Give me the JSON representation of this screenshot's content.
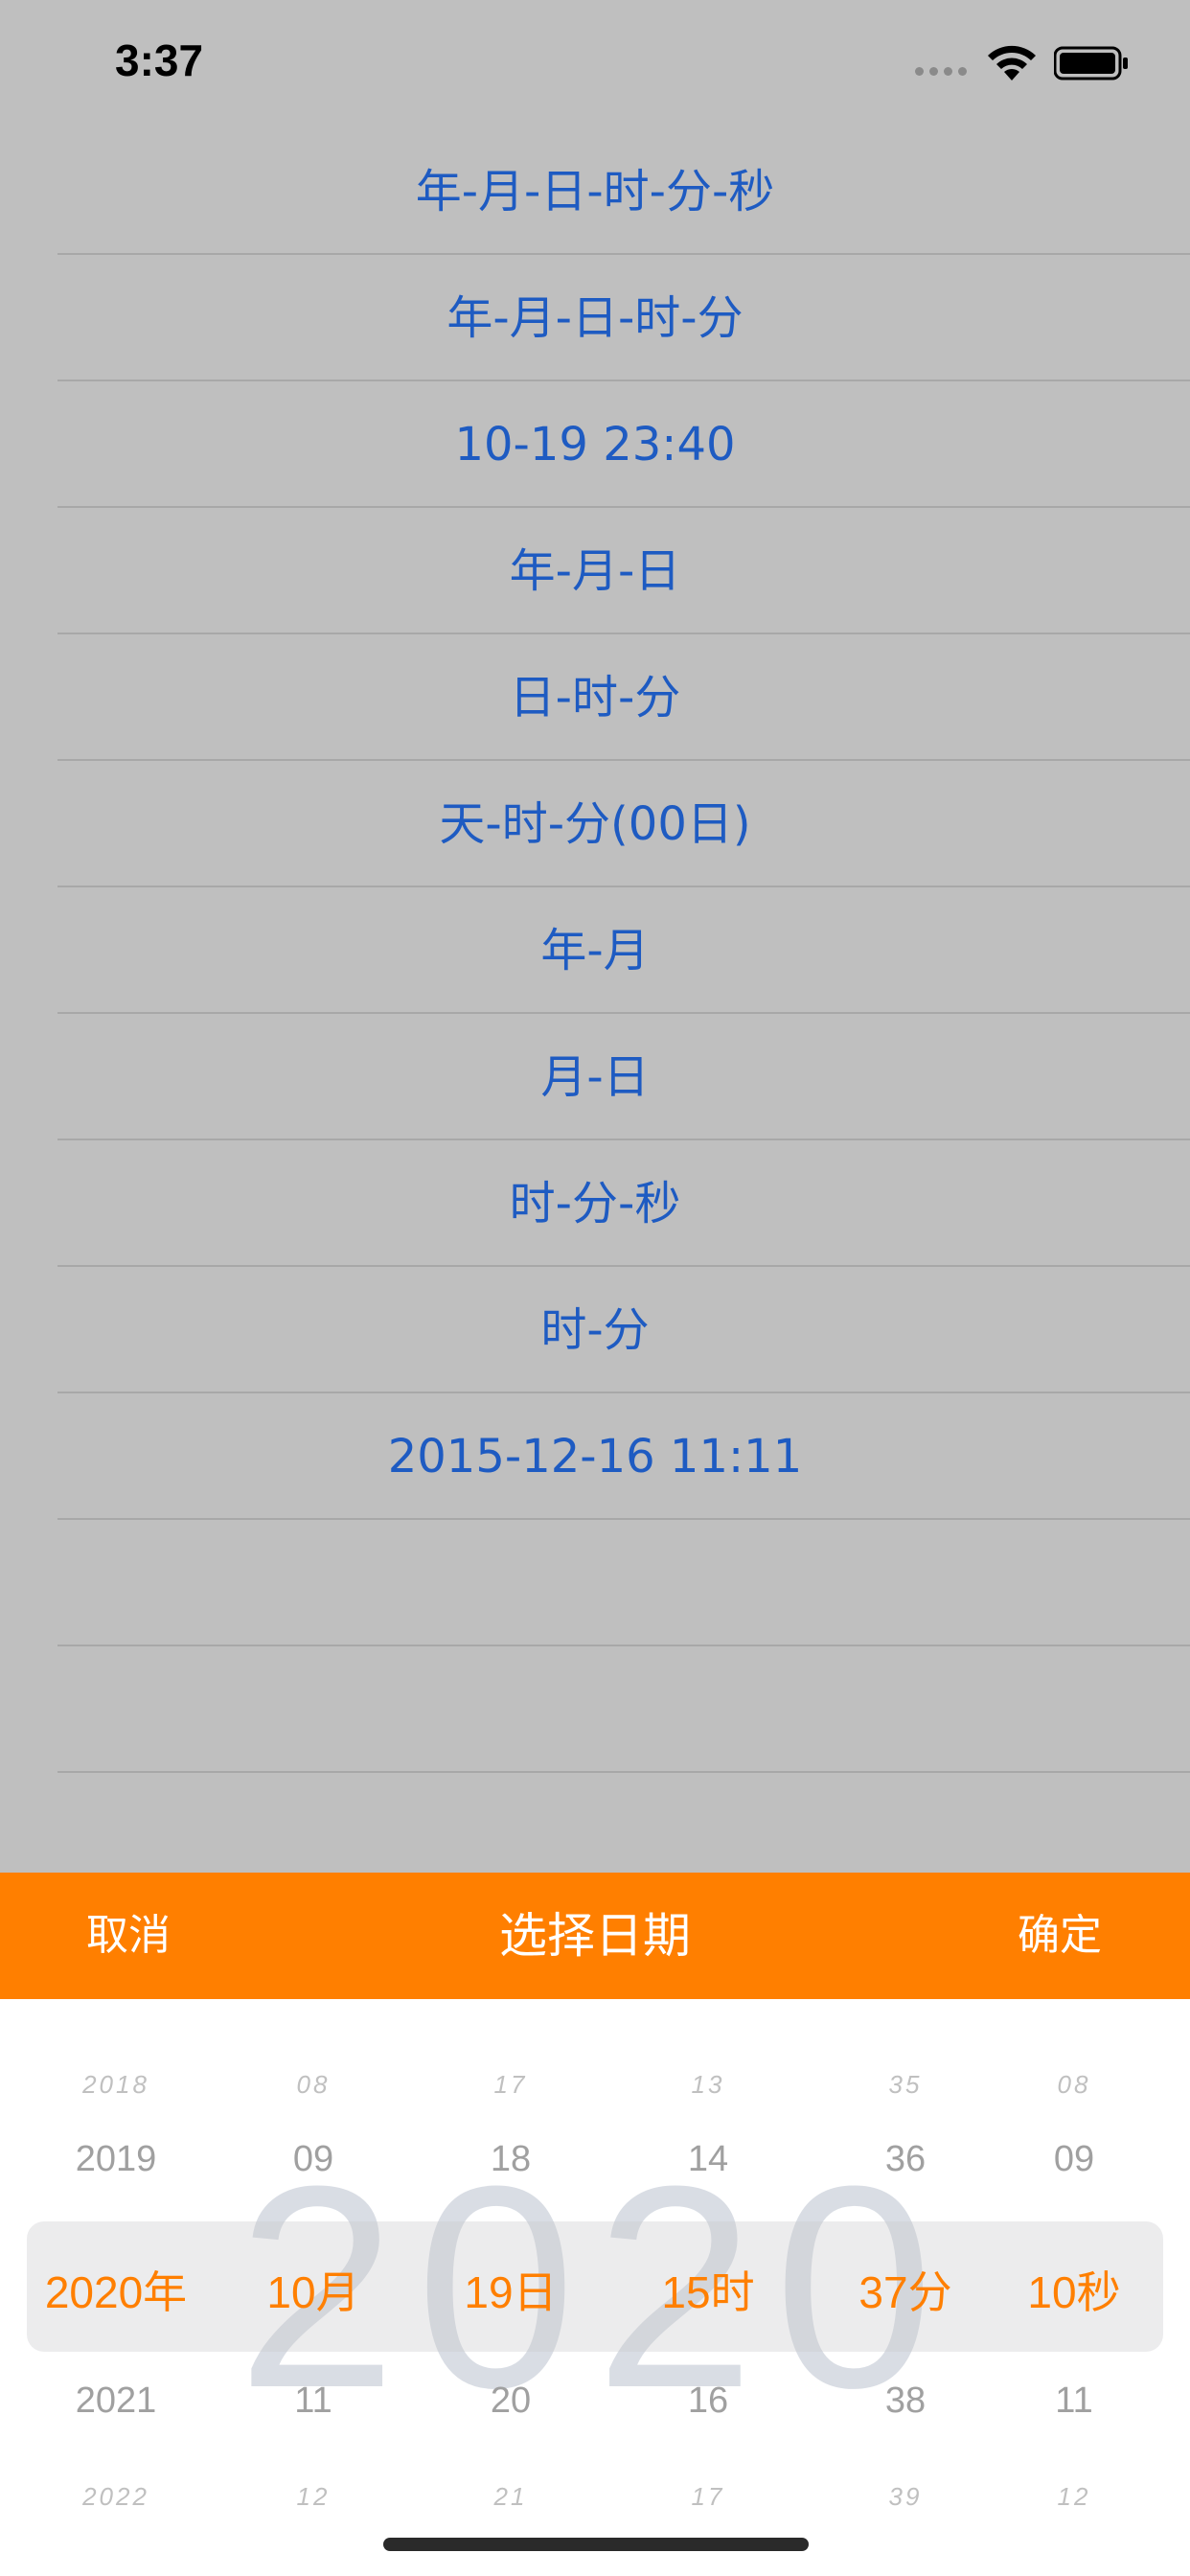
{
  "status_bar": {
    "time": "3:37"
  },
  "list": {
    "rows": [
      "年-月-日-时-分-秒",
      "年-月-日-时-分",
      "10-19 23:40",
      "年-月-日",
      "日-时-分",
      "天-时-分(00日)",
      "年-月",
      "月-日",
      "时-分-秒",
      "时-分",
      "2015-12-16 11:11",
      "",
      ""
    ]
  },
  "toolbar": {
    "cancel_label": "取消",
    "title": "选择日期",
    "confirm_label": "确定"
  },
  "picker": {
    "watermark": "2020",
    "columns": [
      {
        "above2": "2018",
        "above1": "2019",
        "selected": "2020年",
        "below1": "2021",
        "below2": "2022"
      },
      {
        "above2": "08",
        "above1": "09",
        "selected": "10月",
        "below1": "11",
        "below2": "12"
      },
      {
        "above2": "17",
        "above1": "18",
        "selected": "19日",
        "below1": "20",
        "below2": "21"
      },
      {
        "above2": "13",
        "above1": "14",
        "selected": "15时",
        "below1": "16",
        "below2": "17"
      },
      {
        "above2": "35",
        "above1": "36",
        "selected": "37分",
        "below1": "38",
        "below2": "39"
      },
      {
        "above2": "08",
        "above1": "09",
        "selected": "10秒",
        "below1": "11",
        "below2": "12"
      }
    ]
  }
}
